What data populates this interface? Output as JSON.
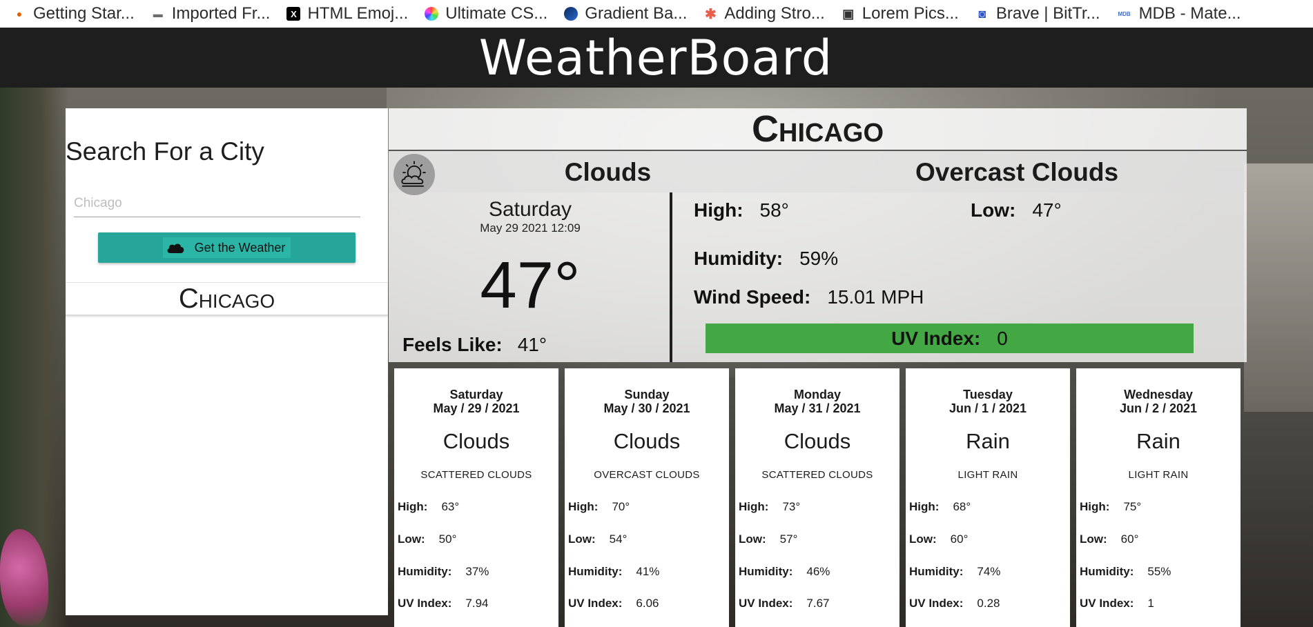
{
  "bookmarks": [
    {
      "label": "Getting Star...",
      "icon": "firefox-icon",
      "color": "#e66000",
      "glyph": "●"
    },
    {
      "label": "Imported Fr...",
      "icon": "folder-icon",
      "color": "#6d6d6d",
      "glyph": "▬"
    },
    {
      "label": "HTML Emoj...",
      "icon": "x-logo-icon",
      "color": "#000000",
      "glyph": "X"
    },
    {
      "label": "Ultimate CS...",
      "icon": "color-wheel-icon",
      "color": "#c84bd8",
      "glyph": "◎"
    },
    {
      "label": "Gradient Ba...",
      "icon": "gradient-circle-icon",
      "color": "#1f4f99",
      "glyph": "●"
    },
    {
      "label": "Adding Stro...",
      "icon": "asterisk-icon",
      "color": "#e8604c",
      "glyph": "✱"
    },
    {
      "label": "Lorem Pics...",
      "icon": "photo-icon",
      "color": "#333333",
      "glyph": "▣"
    },
    {
      "label": "Brave | BitTr...",
      "icon": "bittorrent-icon",
      "color": "#3154c7",
      "glyph": "◙"
    },
    {
      "label": "MDB - Mate...",
      "icon": "mdb-icon",
      "color": "#3b71ca",
      "glyph": "MDB"
    }
  ],
  "header": {
    "title": "WeatherBoard"
  },
  "sidebar": {
    "heading": "Search For a City",
    "search_placeholder": "Chicago",
    "search_value": "",
    "button_label": "Get the Weather",
    "button_color": "#26a69a",
    "history": [
      "Chicago"
    ]
  },
  "current": {
    "city": "Chicago",
    "condition": "Clouds",
    "description": "Overcast Clouds",
    "day": "Saturday",
    "datetime": "May 29 2021 12:09",
    "temp": "47°",
    "feels_like_label": "Feels Like:",
    "feels_like": "41°",
    "high_label": "High:",
    "high": "58°",
    "low_label": "Low:",
    "low": "47°",
    "humidity_label": "Humidity:",
    "humidity": "59%",
    "wind_label": "Wind Speed:",
    "wind": "15.01 MPH",
    "uv_label": "UV Index:",
    "uv": "0",
    "uv_color": "#43a843"
  },
  "forecast_labels": {
    "high": "High:",
    "low": "Low:",
    "humidity": "Humidity:",
    "uv": "UV Index:"
  },
  "forecast": [
    {
      "day": "Saturday",
      "date": "May / 29 / 2021",
      "main": "Clouds",
      "desc": "Scattered Clouds",
      "high": "63°",
      "low": "50°",
      "humidity": "37%",
      "uv": "7.94"
    },
    {
      "day": "Sunday",
      "date": "May / 30 / 2021",
      "main": "Clouds",
      "desc": "Overcast Clouds",
      "high": "70°",
      "low": "54°",
      "humidity": "41%",
      "uv": "6.06"
    },
    {
      "day": "Monday",
      "date": "May / 31 / 2021",
      "main": "Clouds",
      "desc": "Scattered Clouds",
      "high": "73°",
      "low": "57°",
      "humidity": "46%",
      "uv": "7.67"
    },
    {
      "day": "Tuesday",
      "date": "Jun / 1 / 2021",
      "main": "Rain",
      "desc": "Light Rain",
      "high": "68°",
      "low": "60°",
      "humidity": "74%",
      "uv": "0.28"
    },
    {
      "day": "Wednesday",
      "date": "Jun / 2 / 2021",
      "main": "Rain",
      "desc": "Light Rain",
      "high": "75°",
      "low": "60°",
      "humidity": "55%",
      "uv": "1"
    }
  ]
}
